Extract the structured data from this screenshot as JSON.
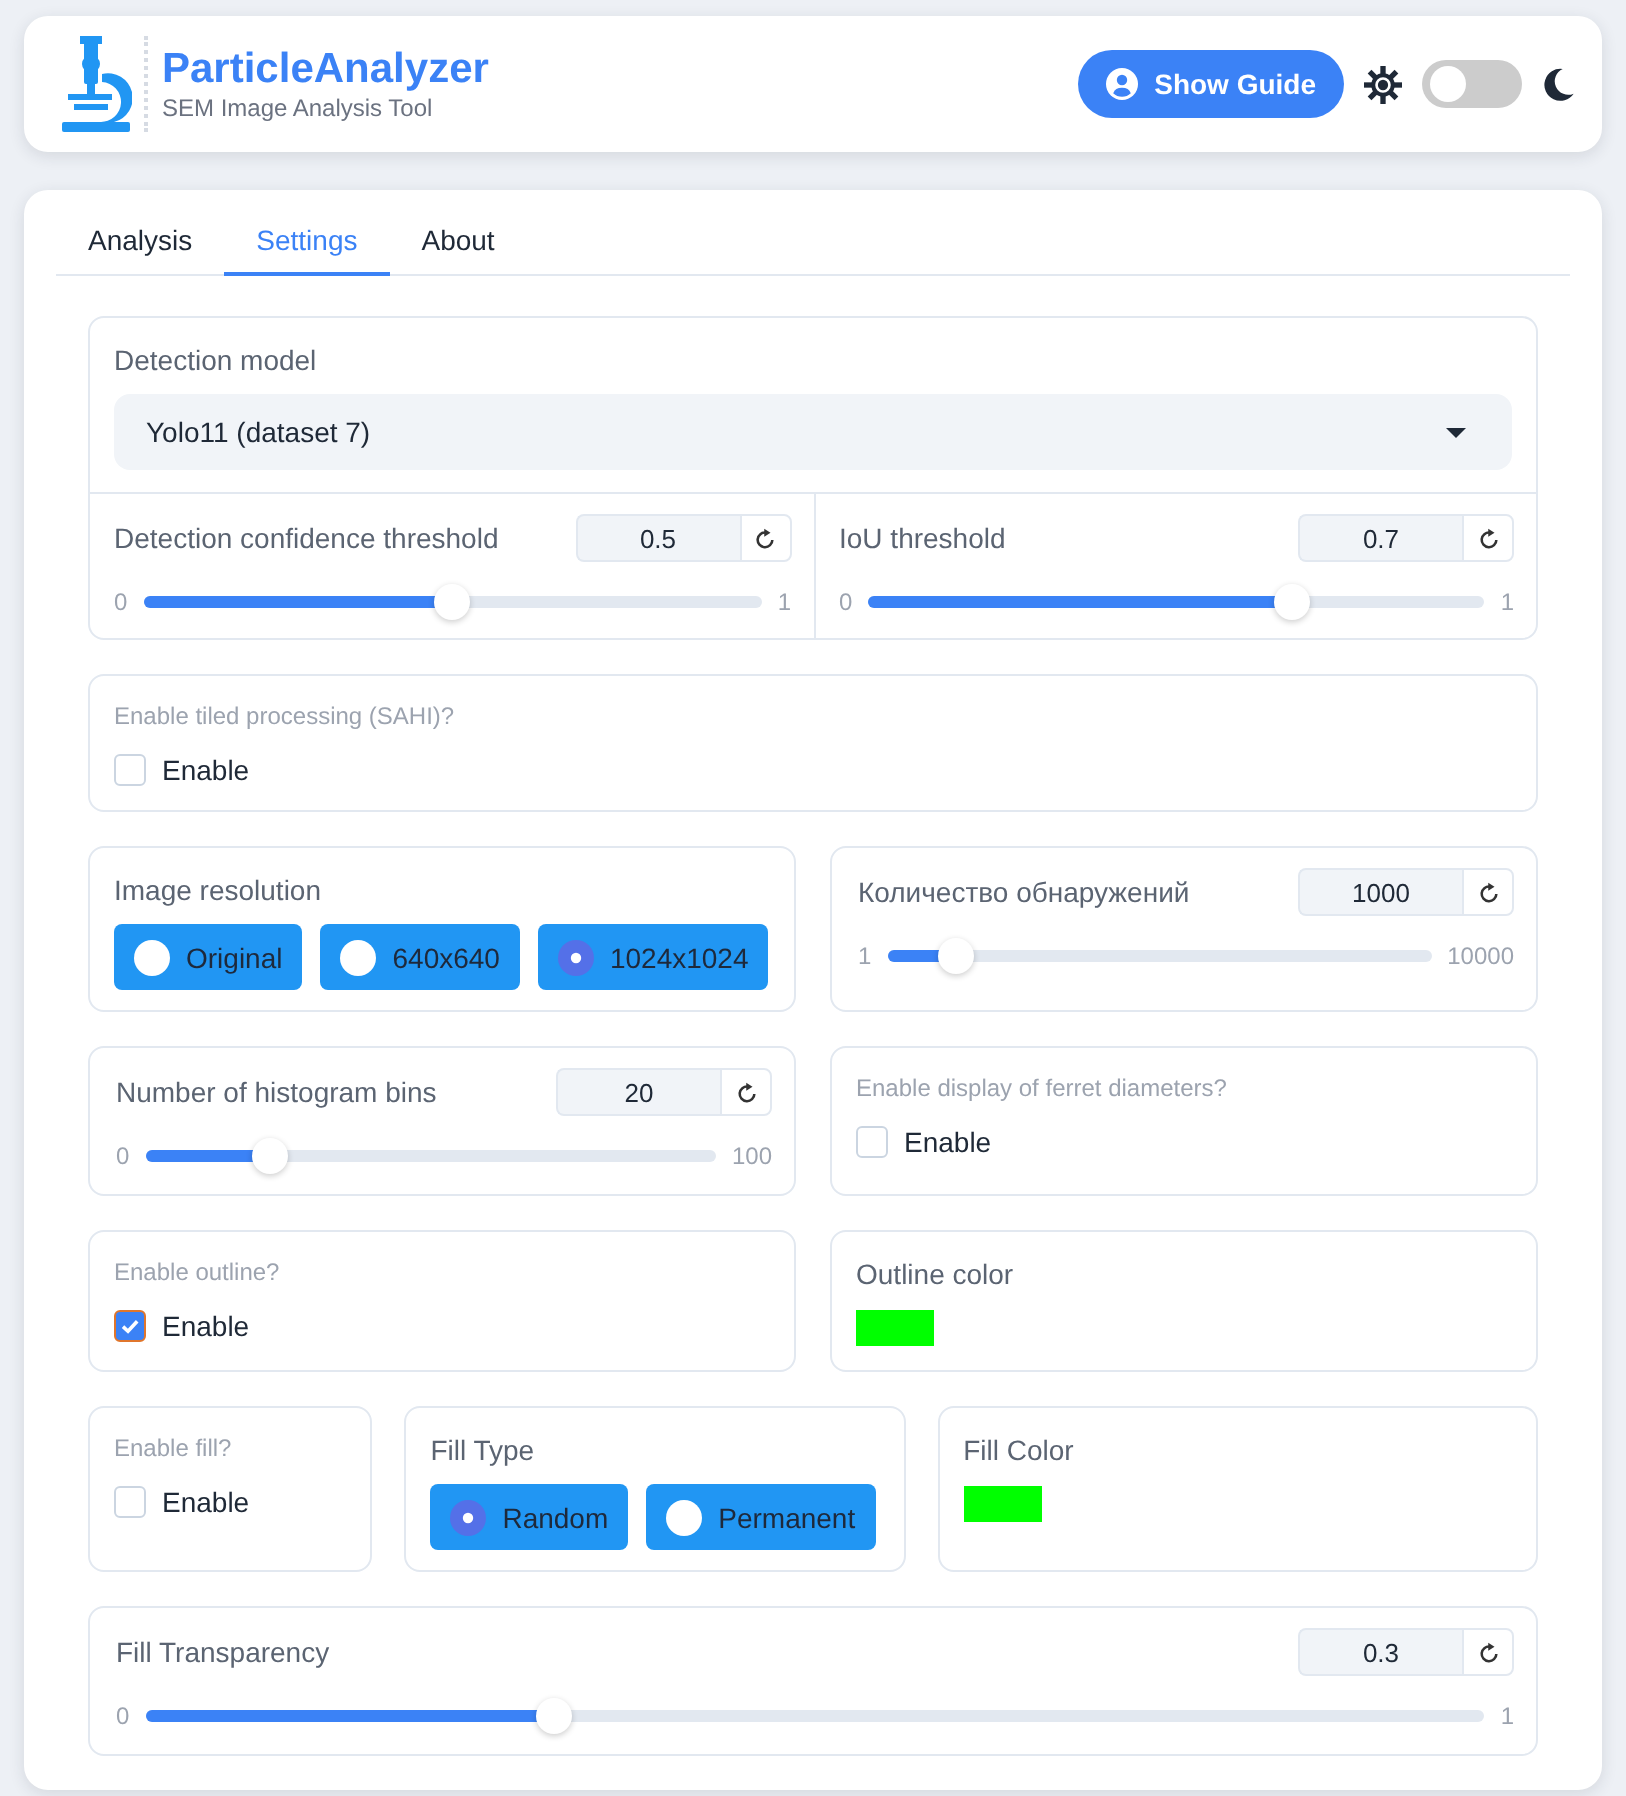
{
  "header": {
    "title": "ParticleAnalyzer",
    "subtitle": "SEM Image Analysis Tool",
    "guide_button": "Show Guide",
    "dark_mode": false
  },
  "tabs": [
    {
      "label": "Analysis",
      "selected": false
    },
    {
      "label": "Settings",
      "selected": true
    },
    {
      "label": "About",
      "selected": false
    }
  ],
  "rows": [
    {
      "panels": [
        {
          "kind": "model",
          "label": "Detection model",
          "value": "Yolo11 (dataset 7)",
          "sliders": [
            {
              "label": "Detection confidence threshold",
              "value": "0.5",
              "min_label": "0",
              "max_label": "1",
              "level": 0.5
            },
            {
              "label": "IoU threshold",
              "value": "0.7",
              "min_label": "0",
              "max_label": "1",
              "level": 0.7
            }
          ]
        }
      ]
    },
    {
      "panels": [
        {
          "kind": "checkbox",
          "question": "Enable tiled processing (SAHI)?",
          "label": "Enable",
          "checked": false
        }
      ]
    },
    {
      "panels": [
        {
          "kind": "radio",
          "label": "Image resolution",
          "options": [
            {
              "label": "Original",
              "selected": false
            },
            {
              "label": "640x640",
              "selected": false
            },
            {
              "label": "1024x1024",
              "selected": true
            }
          ]
        },
        {
          "kind": "slider",
          "label": "Количество обнаружений",
          "value": "1000",
          "min_label": "1",
          "max_label": "10000",
          "level": 0.1
        }
      ]
    },
    {
      "panels": [
        {
          "kind": "slider",
          "label": "Number of histogram bins",
          "value": "20",
          "min_label": "0",
          "max_label": "100",
          "level": 0.2
        },
        {
          "kind": "checkbox",
          "question": "Enable display of ferret diameters?",
          "label": "Enable",
          "checked": false
        }
      ]
    },
    {
      "panels": [
        {
          "kind": "checkbox",
          "question": "Enable outline?",
          "label": "Enable",
          "checked": true
        },
        {
          "kind": "color",
          "label": "Outline color",
          "color": "#00ff00"
        }
      ]
    },
    {
      "panels": [
        {
          "kind": "checkbox",
          "question": "Enable fill?",
          "label": "Enable",
          "checked": false
        },
        {
          "kind": "radio",
          "label": "Fill Type",
          "options": [
            {
              "label": "Random",
              "selected": true
            },
            {
              "label": "Permanent",
              "selected": false
            }
          ]
        },
        {
          "kind": "color",
          "label": "Fill Color",
          "color": "#00ff00"
        }
      ]
    },
    {
      "panels": [
        {
          "kind": "slider",
          "label": "Fill Transparency",
          "value": "0.3",
          "min_label": "0",
          "max_label": "1",
          "level": 0.3
        }
      ]
    }
  ]
}
